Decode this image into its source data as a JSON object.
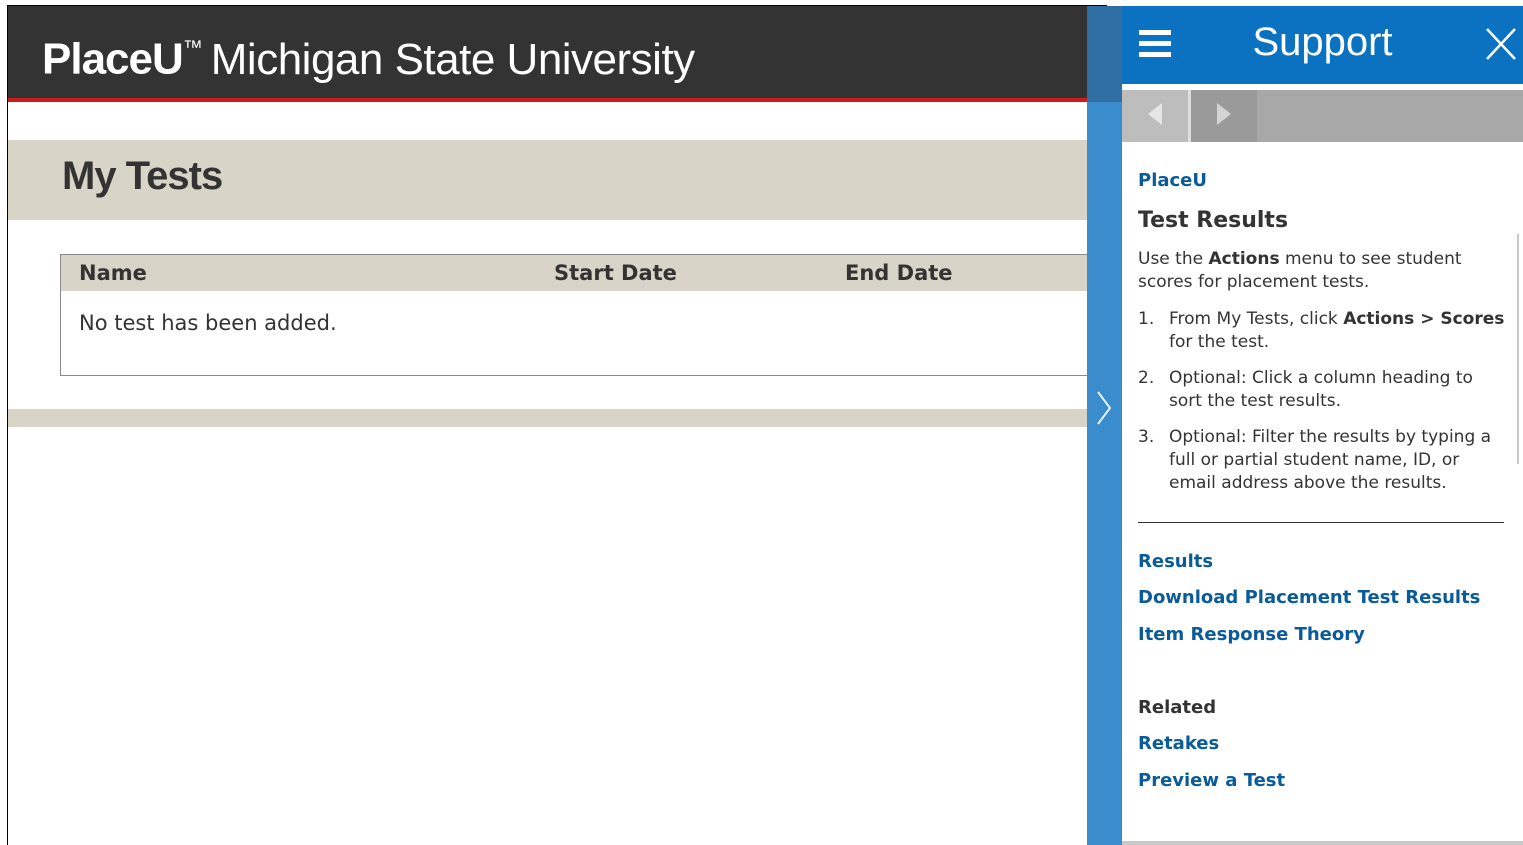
{
  "header": {
    "brand_name": "PlaceU",
    "trademark": "™",
    "university": "Michigan State University"
  },
  "page": {
    "title": "My Tests"
  },
  "table": {
    "columns": [
      "Name",
      "Start Date",
      "End Date"
    ],
    "empty_message": "No test has been added."
  },
  "support": {
    "title": "Support",
    "breadcrumb": "PlaceU",
    "topic_title": "Test Results",
    "intro_prefix": "Use the ",
    "intro_bold": "Actions",
    "intro_suffix": " menu to see student scores for placement tests.",
    "steps": [
      {
        "num": "1.",
        "pre": "From My Tests, click ",
        "bold": "Actions > Scores",
        "post": " for the test."
      },
      {
        "num": "2.",
        "text": "Optional: Click a column heading to sort the test results."
      },
      {
        "num": "3.",
        "text": "Optional: Filter the results by typing a full or partial student name, ID, or email address above the results."
      }
    ],
    "links": [
      "Results",
      "Download Placement Test Results",
      "Item Response Theory"
    ],
    "related_heading": "Related",
    "related_links": [
      "Retakes",
      "Preview a Test"
    ]
  },
  "icons": {
    "menu": "hamburger-menu-icon",
    "close": "close-icon",
    "back": "triangle-left-icon",
    "forward": "triangle-right-icon",
    "collapse": "chevron-right-icon"
  },
  "colors": {
    "header_bg": "#333333",
    "header_accent": "#cc1b1b",
    "band_bg": "#d8d4c8",
    "support_blue": "#0a72c1",
    "link_blue": "#0a5b99"
  }
}
